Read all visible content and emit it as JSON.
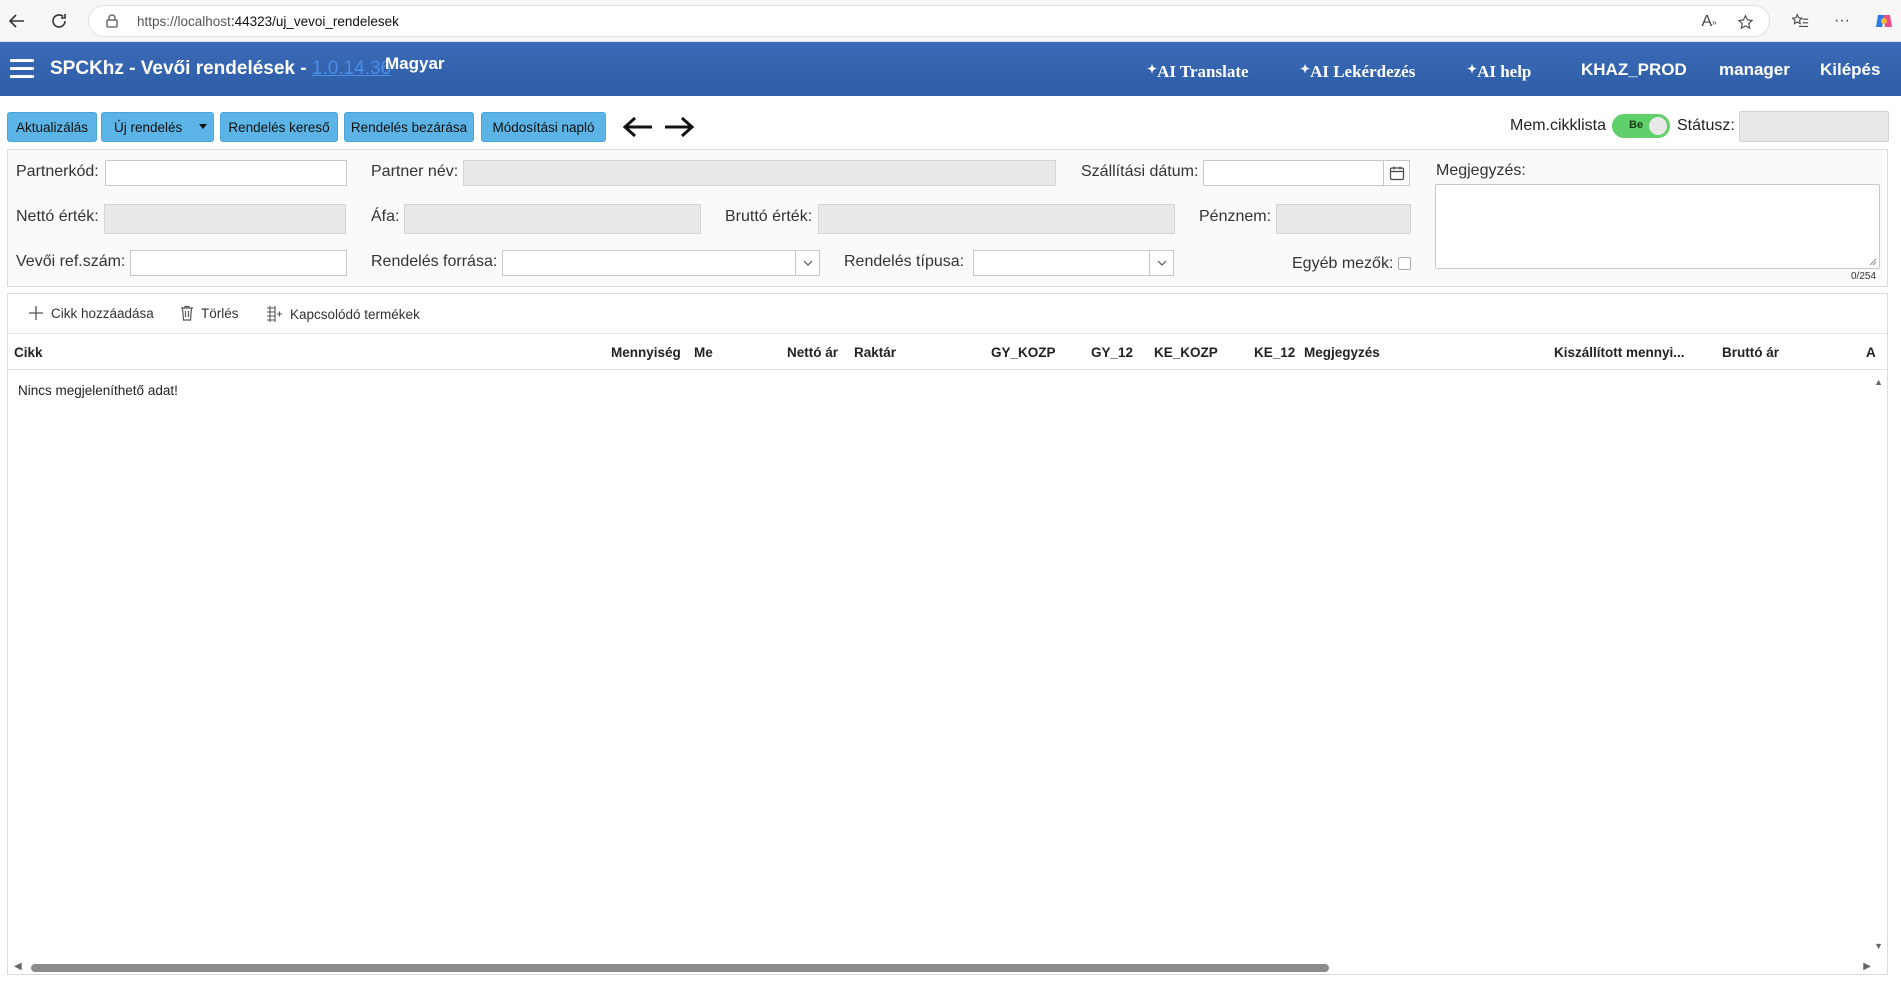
{
  "browser": {
    "url_host": "https://localhost",
    "url_rest": ":44323/uj_vevoi_rendelesek"
  },
  "header": {
    "title": "SPCKhz - Vevői rendelések -",
    "version": "1.0.14.36",
    "language": "Magyar",
    "ai_translate": "AI Translate",
    "ai_query": "AI Lekérdezés",
    "ai_help": "AI help",
    "environment": "KHAZ_PROD",
    "user": "manager",
    "logout": "Kilépés"
  },
  "toolbar": {
    "refresh": "Aktualizálás",
    "new_order": "Új rendelés",
    "order_search": "Rendelés kereső",
    "order_close": "Rendelés bezárása",
    "change_log": "Módosítási napló",
    "mem_label": "Mem.cikklista",
    "toggle_on": "Be",
    "status_label": "Státusz:"
  },
  "form": {
    "partner_code": "Partnerkód:",
    "partner_name": "Partner név:",
    "delivery_date": "Szállítási dátum:",
    "comment": "Megjegyzés:",
    "net_value": "Nettó érték:",
    "vat": "Áfa:",
    "gross_value": "Bruttó érték:",
    "currency": "Pénznem:",
    "customer_ref": "Vevői ref.szám:",
    "order_source": "Rendelés forrása:",
    "order_type": "Rendelés típusa:",
    "other_fields": "Egyéb mezők:",
    "comment_counter": "0/254"
  },
  "grid": {
    "add_item": "Cikk hozzáadása",
    "delete": "Törlés",
    "related": "Kapcsolódó termékek",
    "columns": [
      "Cikk",
      "Mennyiség",
      "Me",
      "Nettó ár",
      "Raktár",
      "GY_KOZP",
      "GY_12",
      "KE_KOZP",
      "KE_12",
      "Megjegyzés",
      "Kiszállított mennyi...",
      "Bruttó ár",
      "A"
    ],
    "empty_message": "Nincs megjeleníthető adat!"
  },
  "colors": {
    "header_bg": "#2f5da6",
    "button_bg": "#5bb4e5",
    "toggle_on": "#5fd06a"
  }
}
